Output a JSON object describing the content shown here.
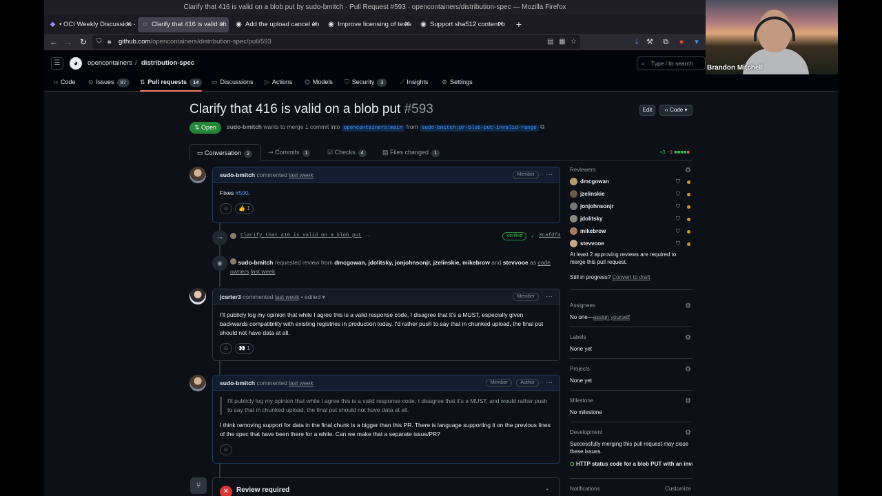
{
  "window": {
    "title": "Clarify that 416 is valid on a blob put by sudo-bmitch · Pull Request #593 · opencontainers/distribution-spec — Mozilla Firefox"
  },
  "tabs": [
    {
      "label": "• OCI Weekly Discussion -",
      "icon": "hackmd-icon"
    },
    {
      "label": "Clarify that 416 is valid on",
      "icon": "github-icon"
    },
    {
      "label": "Add the upload cancel en",
      "icon": "github-icon"
    },
    {
      "label": "Improve licensing of tests",
      "icon": "github-icon"
    },
    {
      "label": "Support sha512 content b",
      "icon": "github-icon"
    }
  ],
  "url": {
    "host": "github.com",
    "path": "/opencontainers/distribution-spec/pull/593"
  },
  "video": {
    "name": "Brandon Mitchell"
  },
  "header": {
    "owner": "opencontainers",
    "repo": "distribution-spec",
    "search_placeholder": "Type / to search"
  },
  "reponav": [
    {
      "label": "Code",
      "icon": "code-icon"
    },
    {
      "label": "Issues",
      "count": "87",
      "icon": "issue-icon"
    },
    {
      "label": "Pull requests",
      "count": "14",
      "icon": "pr-icon"
    },
    {
      "label": "Discussions",
      "icon": "discussion-icon"
    },
    {
      "label": "Actions",
      "icon": "play-icon"
    },
    {
      "label": "Models",
      "icon": "models-icon"
    },
    {
      "label": "Security",
      "count": "3",
      "icon": "shield-icon"
    },
    {
      "label": "Insights",
      "icon": "graph-icon"
    },
    {
      "label": "Settings",
      "icon": "gear-icon"
    }
  ],
  "pr": {
    "title": "Clarify that 416 is valid on a blob put",
    "number": "#593",
    "state": "Open",
    "author": "sudo-bmitch",
    "merge_text": "wants to merge 1 commit into",
    "base": "opencontainers:main",
    "from": "from",
    "head": "sudo-bmitch:pr-blob-put-invalid-range",
    "edit": "Edit",
    "code": "Code",
    "additions": "+3",
    "deletions": "−1"
  },
  "pr_tabs": [
    {
      "label": "Conversation",
      "count": "2"
    },
    {
      "label": "Commits",
      "count": "1"
    },
    {
      "label": "Checks",
      "count": "4"
    },
    {
      "label": "Files changed",
      "count": "1"
    }
  ],
  "comments": [
    {
      "author": "sudo-bmitch",
      "verb": "commented",
      "time": "last week",
      "badge": "Member",
      "body_prefix": "Fixes ",
      "link": "#590",
      "body_suffix": ".",
      "reaction": "👍 1"
    },
    {
      "author": "jcarter3",
      "verb": "commented",
      "time": "last week",
      "edited": "• edited ▾",
      "badge": "Member",
      "body": "I'll publicly log my opinion that while I agree this is a valid response code, I disagree that it's a MUST, especially given backwards compatibility with existing registries in production today. I'd rather push to say that in chunked upload, the final put should not have data at all.",
      "reaction": "👀 1"
    },
    {
      "author": "sudo-bmitch",
      "verb": "commented",
      "time": "last week",
      "badge": "Member",
      "badge2": "Author",
      "quote": "I'll publicly log my opinion that while I agree this is a valid response code, I disagree that it's a MUST, and would rather push to say that in chunked upload, the final put should not have data at all.",
      "body": "I think removing support for data in the final chunk is a bigger than this PR. There is language supporting it on the previous lines of the spec that have been there for a while. Can we make that a separate issue/PR?"
    }
  ],
  "commit_event": {
    "message": "Clarify that 416 is valid on a blob put",
    "verified": "Verified",
    "sha": "3cafdf4"
  },
  "review_event": {
    "author": "sudo-bmitch",
    "text": "requested review from",
    "reviewers": "dmcgowan, jdolitsky, jonjohnsonjr, jzelinskie, mikebrow",
    "and": "and",
    "last": "stevvooe",
    "as": "as",
    "code_owners": "code owners",
    "time": "last week"
  },
  "review_box": {
    "title": "Review required"
  },
  "sidebar": {
    "reviewers_title": "Reviewers",
    "reviewers": [
      "dmcgowan",
      "jzelinskie",
      "jonjohnsonjr",
      "jdolitsky",
      "mikebrow",
      "stevvooe"
    ],
    "reviewers_note": "At least 2 approving reviews are required to merge this pull request.",
    "progress": "Still in progress?",
    "convert": "Convert to draft",
    "assignees_title": "Assignees",
    "assignees_none": "No one—",
    "assign_self": "assign yourself",
    "labels_title": "Labels",
    "labels_none": "None yet",
    "projects_title": "Projects",
    "projects_none": "None yet",
    "milestone_title": "Milestone",
    "milestone_none": "No milestone",
    "development_title": "Development",
    "development_note": "Successfully merging this pull request may close these issues.",
    "development_issue": "HTTP status code for a blob PUT with an inval...",
    "notifications_title": "Notifications",
    "customize": "Customize"
  }
}
